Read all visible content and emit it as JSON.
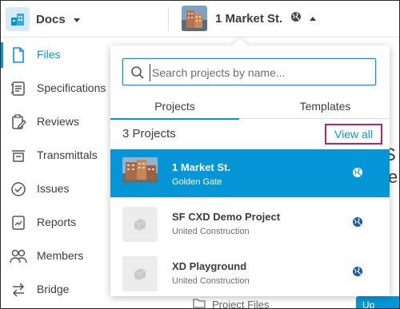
{
  "topbar": {
    "app_name": "Docs",
    "project_title": "1 Market St."
  },
  "sidebar": {
    "items": [
      {
        "label": "Files",
        "icon": "file-icon",
        "active": true
      },
      {
        "label": "Specifications",
        "icon": "specifications-icon",
        "active": false
      },
      {
        "label": "Reviews",
        "icon": "reviews-icon",
        "active": false
      },
      {
        "label": "Transmittals",
        "icon": "transmittals-icon",
        "active": false
      },
      {
        "label": "Issues",
        "icon": "issues-icon",
        "active": false
      },
      {
        "label": "Reports",
        "icon": "reports-icon",
        "active": false
      },
      {
        "label": "Members",
        "icon": "members-icon",
        "active": false
      },
      {
        "label": "Bridge",
        "icon": "bridge-icon",
        "active": false
      }
    ]
  },
  "dropdown": {
    "search_placeholder": "Search projects by name...",
    "tabs": [
      {
        "label": "Projects",
        "active": true
      },
      {
        "label": "Templates",
        "active": false
      }
    ],
    "count_label": "3 Projects",
    "view_all_label": "View all",
    "projects": [
      {
        "name": "1 Market St.",
        "org": "Golden Gate",
        "selected": true
      },
      {
        "name": "SF CXD Demo Project",
        "org": "United Construction",
        "selected": false
      },
      {
        "name": "XD Playground",
        "org": "United Construction",
        "selected": false
      }
    ]
  },
  "background": {
    "folder_label": "Project Files",
    "upload_label": "Up"
  },
  "colors": {
    "accent": "#0696d7",
    "highlight_border": "#b5246f",
    "text": "#3c3c3c"
  }
}
